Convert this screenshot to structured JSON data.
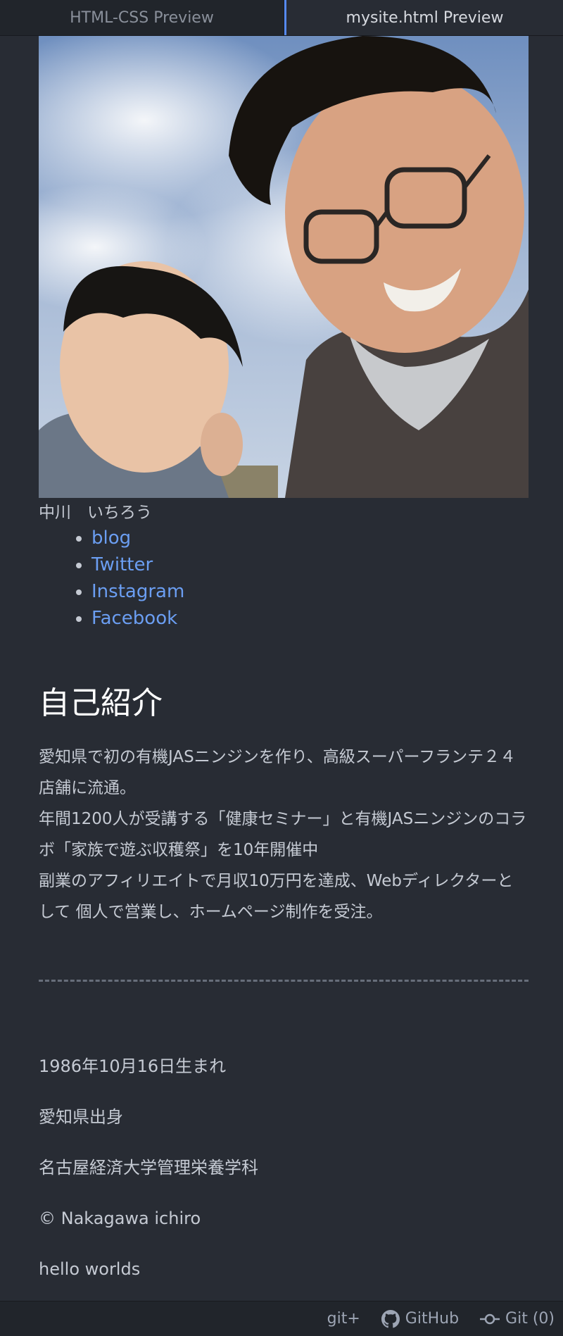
{
  "tabs": [
    {
      "label": "HTML-CSS Preview",
      "active": false
    },
    {
      "label": "mysite.html Preview",
      "active": true
    }
  ],
  "profile": {
    "photo_icon": "profile-photo",
    "name": "中川　いちろう",
    "links": [
      "blog",
      "Twitter",
      "Instagram",
      "Facebook"
    ]
  },
  "intro": {
    "heading": "自己紹介",
    "lines": [
      "愛知県で初の有機JASニンジンを作り、高級スーパーフランテ２４店舗に流通。",
      "年間1200人が受講する「健康セミナー」と有機JASニンジンのコラボ「家族で遊ぶ収穫祭」を10年開催中",
      "副業のアフィリエイトで月収10万円を達成、Webディレクターとして 個人で営業し、ホームページ制作を受注。"
    ]
  },
  "facts": [
    "1986年10月16日生まれ",
    "愛知県出身",
    "名古屋経済大学管理栄養学科",
    "© Nakagawa ichiro",
    "hello worlds"
  ],
  "statusbar": {
    "git_plus": "git+",
    "github": "GitHub",
    "git": "Git (0)"
  },
  "colors": {
    "background": "#282c34",
    "link": "#6b9ef2",
    "accent": "#568af2"
  }
}
